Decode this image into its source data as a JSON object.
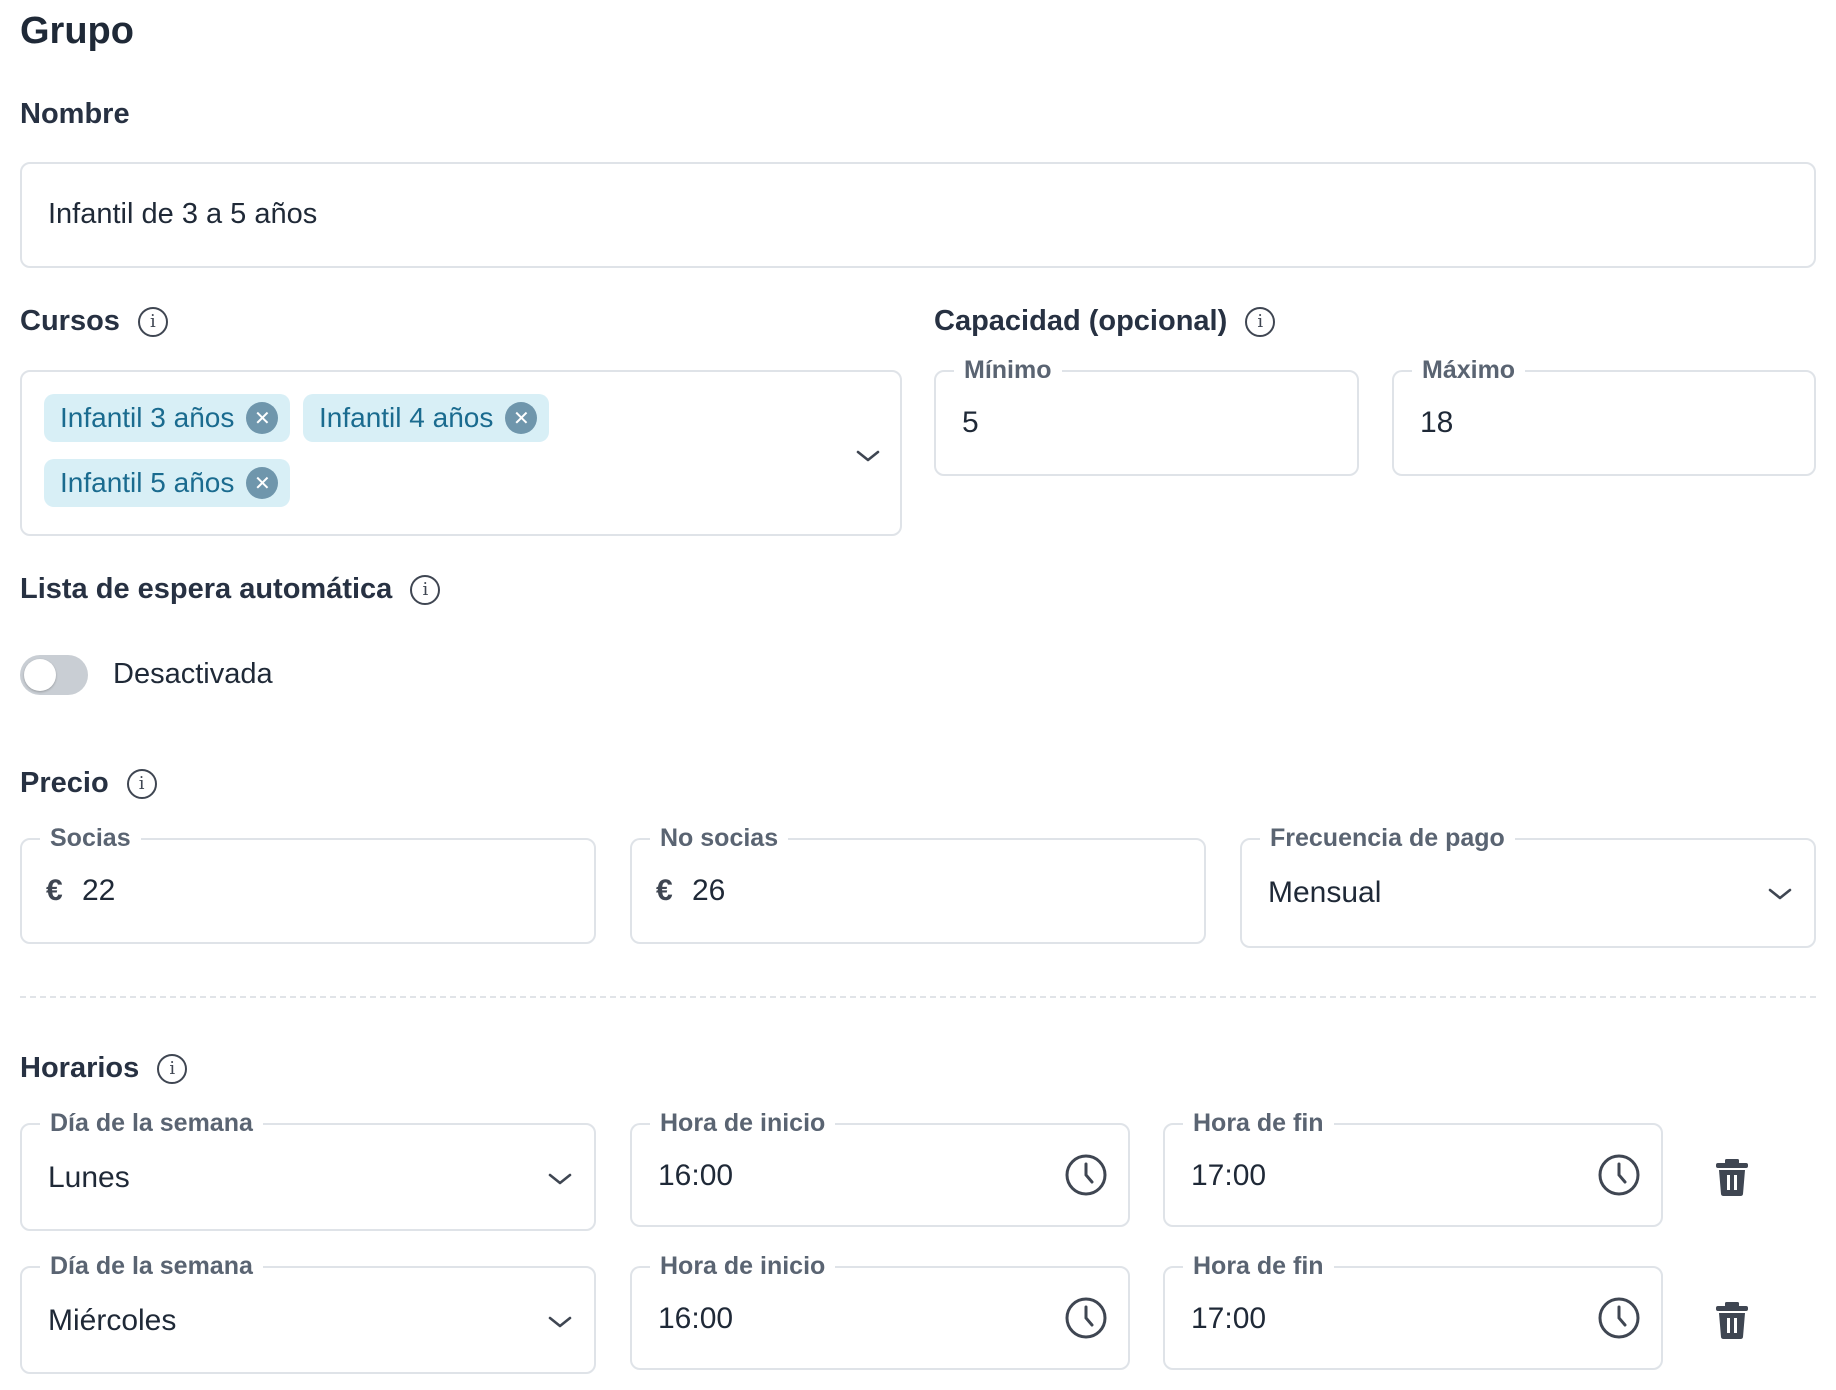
{
  "title": "Grupo",
  "nombre": {
    "label": "Nombre",
    "value": "Infantil de 3 a 5 años"
  },
  "cursos": {
    "label": "Cursos",
    "chips": [
      "Infantil 3 años",
      "Infantil 4 años",
      "Infantil 5 años"
    ]
  },
  "capacidad": {
    "label": "Capacidad (opcional)",
    "min_label": "Mínimo",
    "min_value": "5",
    "max_label": "Máximo",
    "max_value": "18"
  },
  "lista_espera": {
    "label": "Lista de espera automática",
    "toggle_text": "Desactivada",
    "enabled": false
  },
  "precio": {
    "label": "Precio",
    "socias_label": "Socias",
    "socias_currency": "€",
    "socias_value": "22",
    "nosocias_label": "No socias",
    "nosocias_currency": "€",
    "nosocias_value": "26",
    "frecuencia_label": "Frecuencia de pago",
    "frecuencia_value": "Mensual"
  },
  "horarios": {
    "label": "Horarios",
    "rows": [
      {
        "dia_label": "Día de la semana",
        "dia": "Lunes",
        "inicio_label": "Hora de inicio",
        "inicio": "16:00",
        "fin_label": "Hora de fin",
        "fin": "17:00"
      },
      {
        "dia_label": "Día de la semana",
        "dia": "Miércoles",
        "inicio_label": "Hora de inicio",
        "inicio": "16:00",
        "fin_label": "Hora de fin",
        "fin": "17:00"
      }
    ]
  },
  "colors": {
    "chip_bg": "#d8eff6",
    "chip_text": "#1a6b8f",
    "border": "#dfe3e8",
    "toggle_off": "#c9ced4"
  },
  "icons": [
    "info-icon",
    "chevron-down-icon",
    "close-icon",
    "clock-icon",
    "trash-icon"
  ]
}
